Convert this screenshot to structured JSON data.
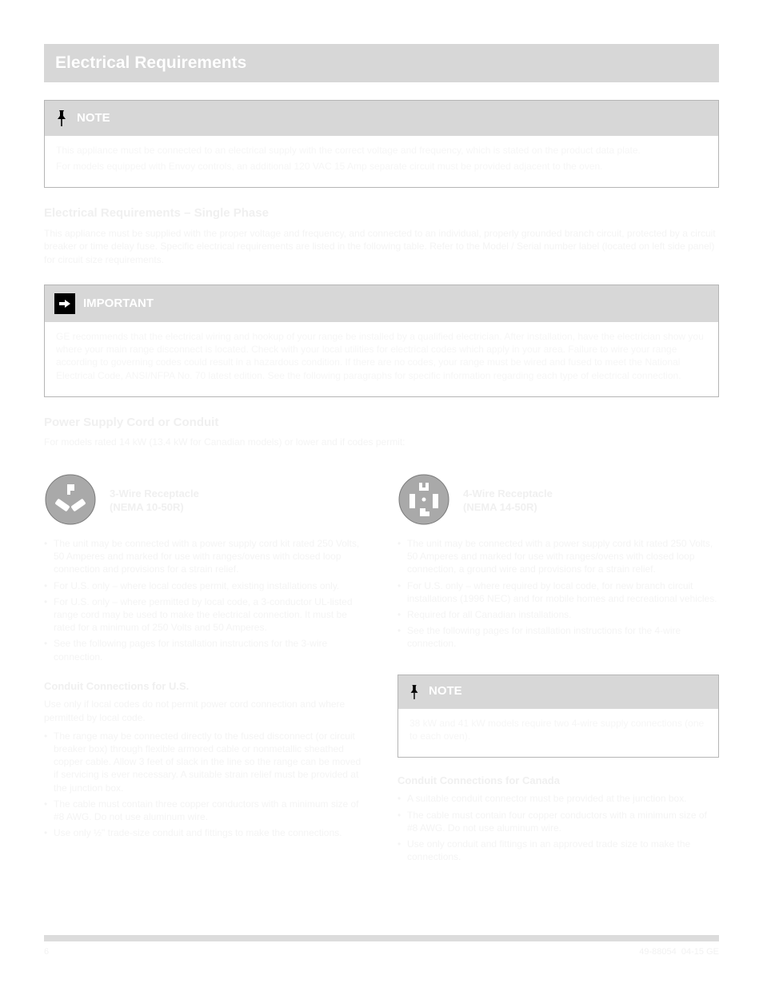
{
  "banner": {
    "title": "Electrical Requirements"
  },
  "noteEnvoy": {
    "label": "NOTE",
    "body1": "This appliance must be connected to an electrical supply with the correct voltage and frequency, which is stated on the product data plate.",
    "body2": "For models equipped with Envoy controls, an additional 120 VAC 15 Amp separate circuit must be provided adjacent to the oven."
  },
  "subhead1": "Electrical Requirements – Single Phase",
  "paraSingle": "This appliance must be supplied with the proper voltage and frequency, and connected to an individual, properly grounded branch circuit, protected by a circuit breaker or time delay fuse. Specific electrical requirements are listed in the following table. Refer to the Model / Serial number label (located on left side panel) for circuit size requirements.",
  "important": {
    "label": "IMPORTANT",
    "body": "GE recommends that the electrical wiring and hookup of your range be installed by a qualified electrician. After installation, have the electrician show you where your main range disconnect is located. Check with your local utilities for electrical codes which apply in your area. Failure to wire your range according to governing codes could result in a hazardous condition. If there are no codes, your range must be wired and fused to meet the National Electrical Code, ANSI/NFPA No. 70 latest edition. See the following paragraphs for specific information regarding each type of electrical connection."
  },
  "subhead2": "Power Supply Cord or Conduit",
  "paraPowerIntro": "For models rated 14 kW (13.4 kW for Canadian models) or lower and if codes permit:",
  "cols": {
    "left": {
      "title": "3-Wire Receptacle\n(NEMA 10-50R)",
      "bullets": [
        "The unit may be connected with a power supply cord kit rated 250 Volts, 50 Amperes and marked for use with ranges/ovens with closed loop connection and provisions for a strain relief.",
        "For U.S. only – where local codes permit, existing installations only.",
        "For U.S. only – where permitted by local code, a 3-conductor UL-listed range cord may be used to make the electrical connection. It must be rated for a minimum of 250 Volts and 50 Amperes.",
        "See the following pages for installation instructions for the 3-wire connection."
      ],
      "sub2": "Conduit Connections for U.S.",
      "conduitIntro": "Use only if local codes do not permit power cord connection and where permitted by local code.",
      "conduitBullets": [
        "The range may be connected directly to the fused disconnect (or circuit breaker box) through flexible armored cable or nonmetallic sheathed copper cable. Allow 3 feet of slack in the line so the range can be moved if servicing is ever necessary. A suitable strain relief must be provided at the junction box.",
        "The cable must contain three copper conductors with a minimum size of #8 AWG. Do not use aluminum wire.",
        "Use only ½\" trade-size conduit and fittings to make the connections."
      ]
    },
    "right": {
      "title": "4-Wire Receptacle\n(NEMA 14-50R)",
      "bullets": [
        "The unit may be connected with a power supply cord kit rated 250 Volts, 50 Amperes and marked for use with ranges/ovens with closed loop connection, a ground wire and provisions for a strain relief.",
        "For U.S. only – where required by local code, for new branch circuit installations (1996 NEC) and for mobile homes and recreational vehicles.",
        "Required for all Canadian installations.",
        "See the following pages for installation instructions for the 4-wire connection."
      ],
      "noteLabel": "NOTE",
      "noteBody": "38 kW and 41 kW models require two 4-wire supply connections (one to each oven).",
      "sub2R": "Conduit Connections for Canada",
      "conduitR": [
        "A suitable conduit connector must be provided at the junction box.",
        "The cable must contain four copper conductors with a minimum size of #8 AWG. Do not use aluminum wire.",
        "Use only conduit and fittings in an approved trade size to make the connections."
      ]
    }
  },
  "footer": {
    "page": "6",
    "doc": "49-88054",
    "rev": "04-15 GE"
  }
}
